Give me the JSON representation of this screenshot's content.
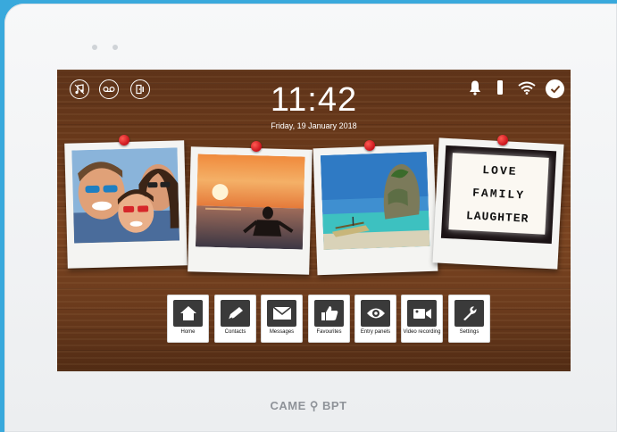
{
  "status_bar": {
    "left_icons": [
      "music-note-icon",
      "voicemail-icon",
      "door-access-icon"
    ],
    "right_icons": [
      "bell-icon",
      "phone-handset-icon",
      "wifi-icon",
      "check-icon"
    ]
  },
  "clock": {
    "time": "11:42",
    "date": "Friday, 19 January 2018"
  },
  "photos": [
    {
      "subject": "family-selfie"
    },
    {
      "subject": "sunset-swimmer"
    },
    {
      "subject": "tropical-beach"
    },
    {
      "subject": "lightbox-sign",
      "sign_lines": [
        "LOVE",
        "FAMILY",
        "LAUGHTER"
      ]
    }
  ],
  "dock": [
    {
      "label": "Home",
      "icon": "home-icon"
    },
    {
      "label": "Contacts",
      "icon": "contacts-icon"
    },
    {
      "label": "Messages",
      "icon": "envelope-icon"
    },
    {
      "label": "Favourites",
      "icon": "thumbs-up-icon"
    },
    {
      "label": "Entry panels",
      "icon": "eye-icon"
    },
    {
      "label": "Video recording",
      "icon": "video-camera-icon"
    },
    {
      "label": "Settings",
      "icon": "wrench-icon"
    }
  ],
  "brand": "CAME ⚲ BPT",
  "colors": {
    "background": "#39a9dc",
    "pin": "#d7161f",
    "icon_tile": "#3a3a3a"
  }
}
